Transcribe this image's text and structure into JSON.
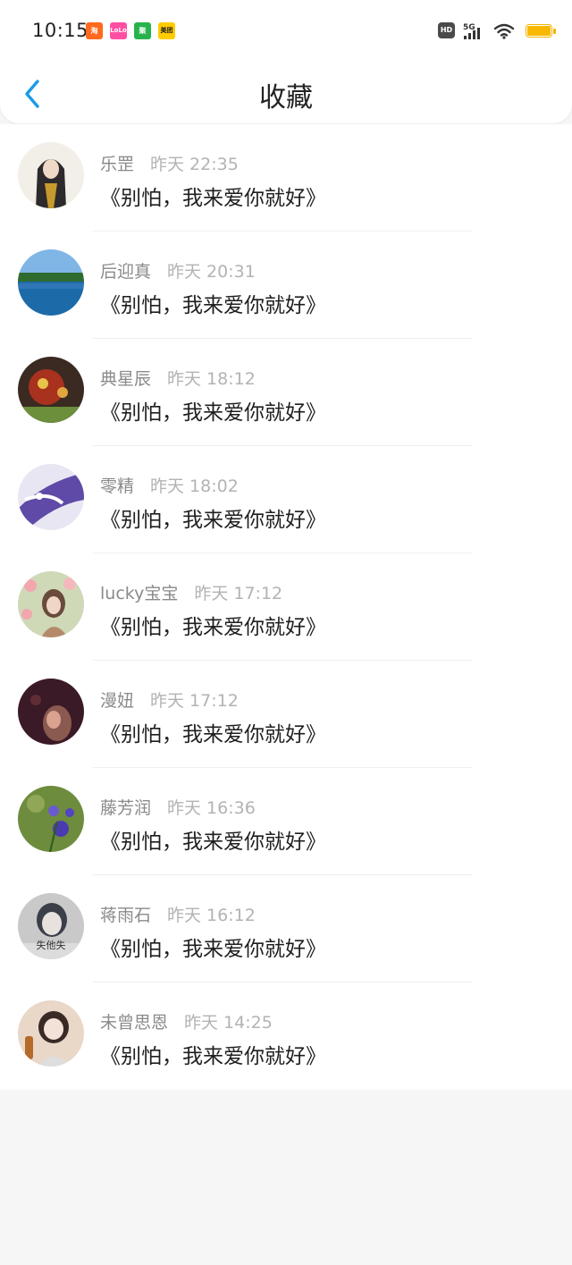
{
  "status_bar": {
    "time": "10:15",
    "apps": [
      {
        "label": "淘",
        "color": "#ff6a1f"
      },
      {
        "label": "LoLo",
        "color": "#ff4fa3"
      },
      {
        "label": "聚",
        "color": "#27b34b"
      },
      {
        "label": "美团",
        "color": "#ffcc00"
      }
    ],
    "hd": "HD",
    "network": "5G",
    "battery_color": "#f8b800"
  },
  "header": {
    "title": "收藏",
    "back_icon": "chevron-left-icon",
    "accent": "#1a9be8"
  },
  "favorites": [
    {
      "name": "乐罡",
      "time": "昨天 22:35",
      "content": "《别怕，我来爱你就好》",
      "avatar": "#2c2a2a"
    },
    {
      "name": "后迎真",
      "time": "昨天 20:31",
      "content": "《别怕，我来爱你就好》",
      "avatar": "#1d6aa8"
    },
    {
      "name": "典星辰",
      "time": "昨天 18:12",
      "content": "《别怕，我来爱你就好》",
      "avatar": "#a8321d"
    },
    {
      "name": "零精",
      "time": "昨天 18:02",
      "content": "《别怕，我来爱你就好》",
      "avatar": "#5f4aa7"
    },
    {
      "name": "lucky宝宝",
      "time": "昨天 17:12",
      "content": "《别怕，我来爱你就好》",
      "avatar": "#b58a6a"
    },
    {
      "name": "漫妞",
      "time": "昨天 17:12",
      "content": "《别怕，我来爱你就好》",
      "avatar": "#3a1a26"
    },
    {
      "name": "藤芳润",
      "time": "昨天 16:36",
      "content": "《别怕，我来爱你就好》",
      "avatar": "#6d8c3d"
    },
    {
      "name": "蒋雨石",
      "time": "昨天 16:12",
      "content": "《别怕，我来爱你就好》",
      "avatar": "#c9c9c9",
      "avatar_text": "失他失"
    },
    {
      "name": "未曾思恩",
      "time": "昨天 14:25",
      "content": "《别怕，我来爱你就好》",
      "avatar": "#e9d7c8"
    }
  ]
}
